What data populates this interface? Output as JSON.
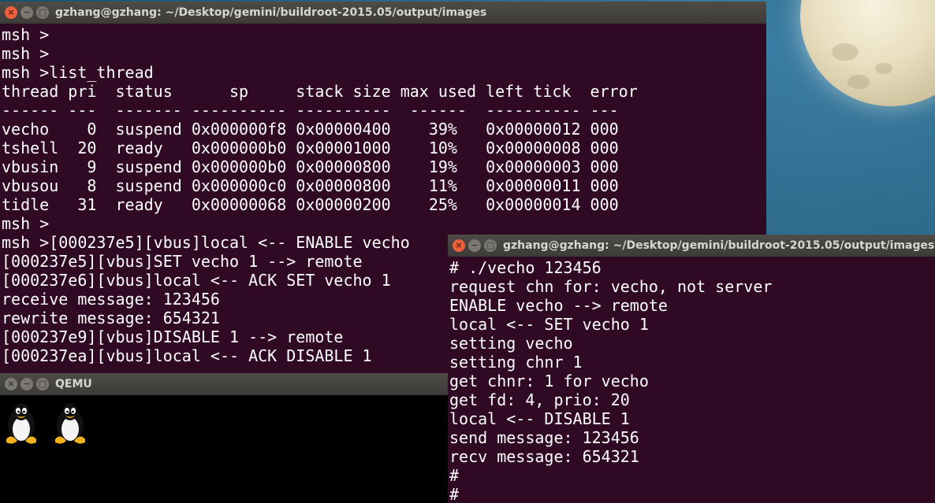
{
  "main_terminal": {
    "title": "gzhang@gzhang: ~/Desktop/gemini/buildroot-2015.05/output/images",
    "lines": [
      "msh >",
      "msh >",
      "msh >list_thread",
      "thread pri  status      sp     stack size max used left tick  error",
      "------ ---  ------- ---------- ----------  ------  ---------- ---",
      "vecho    0  suspend 0x000000f8 0x00000400    39%   0x00000012 000",
      "tshell  20  ready   0x000000b0 0x00001000    10%   0x00000008 000",
      "vbusin   9  suspend 0x000000b0 0x00000800    19%   0x00000003 000",
      "vbusou   8  suspend 0x000000c0 0x00000800    11%   0x00000011 000",
      "tidle   31  ready   0x00000068 0x00000200    25%   0x00000014 000",
      "msh >",
      "msh >[000237e5][vbus]local <-- ENABLE vecho",
      "[000237e5][vbus]SET vecho 1 --> remote",
      "[000237e6][vbus]local <-- ACK SET vecho 1",
      "receive message: 123456",
      "rewrite message: 654321",
      "[000237e9][vbus]DISABLE 1 --> remote",
      "[000237ea][vbus]local <-- ACK DISABLE 1"
    ]
  },
  "qemu_window": {
    "title": "QEMU",
    "logo_count": 2
  },
  "second_terminal": {
    "title": "gzhang@gzhang: ~/Desktop/gemini/buildroot-2015.05/output/images",
    "lines": [
      "# ./vecho 123456",
      "request chn for: vecho, not server",
      "ENABLE vecho --> remote",
      "local <-- SET vecho 1",
      "setting vecho",
      "setting chnr 1",
      "get chnr: 1 for vecho",
      "get fd: 4, prio: 20",
      "local <-- DISABLE 1",
      "send message: 123456",
      "recv message: 654321",
      "#",
      "#"
    ]
  },
  "window_buttons": {
    "close": "×",
    "minimize": "−",
    "maximize": "□"
  },
  "colors": {
    "terminal_bg": "#300a24",
    "terminal_fg": "#ffffff",
    "titlebar_bg": "#3d3b37",
    "close_button": "#e8603c"
  }
}
